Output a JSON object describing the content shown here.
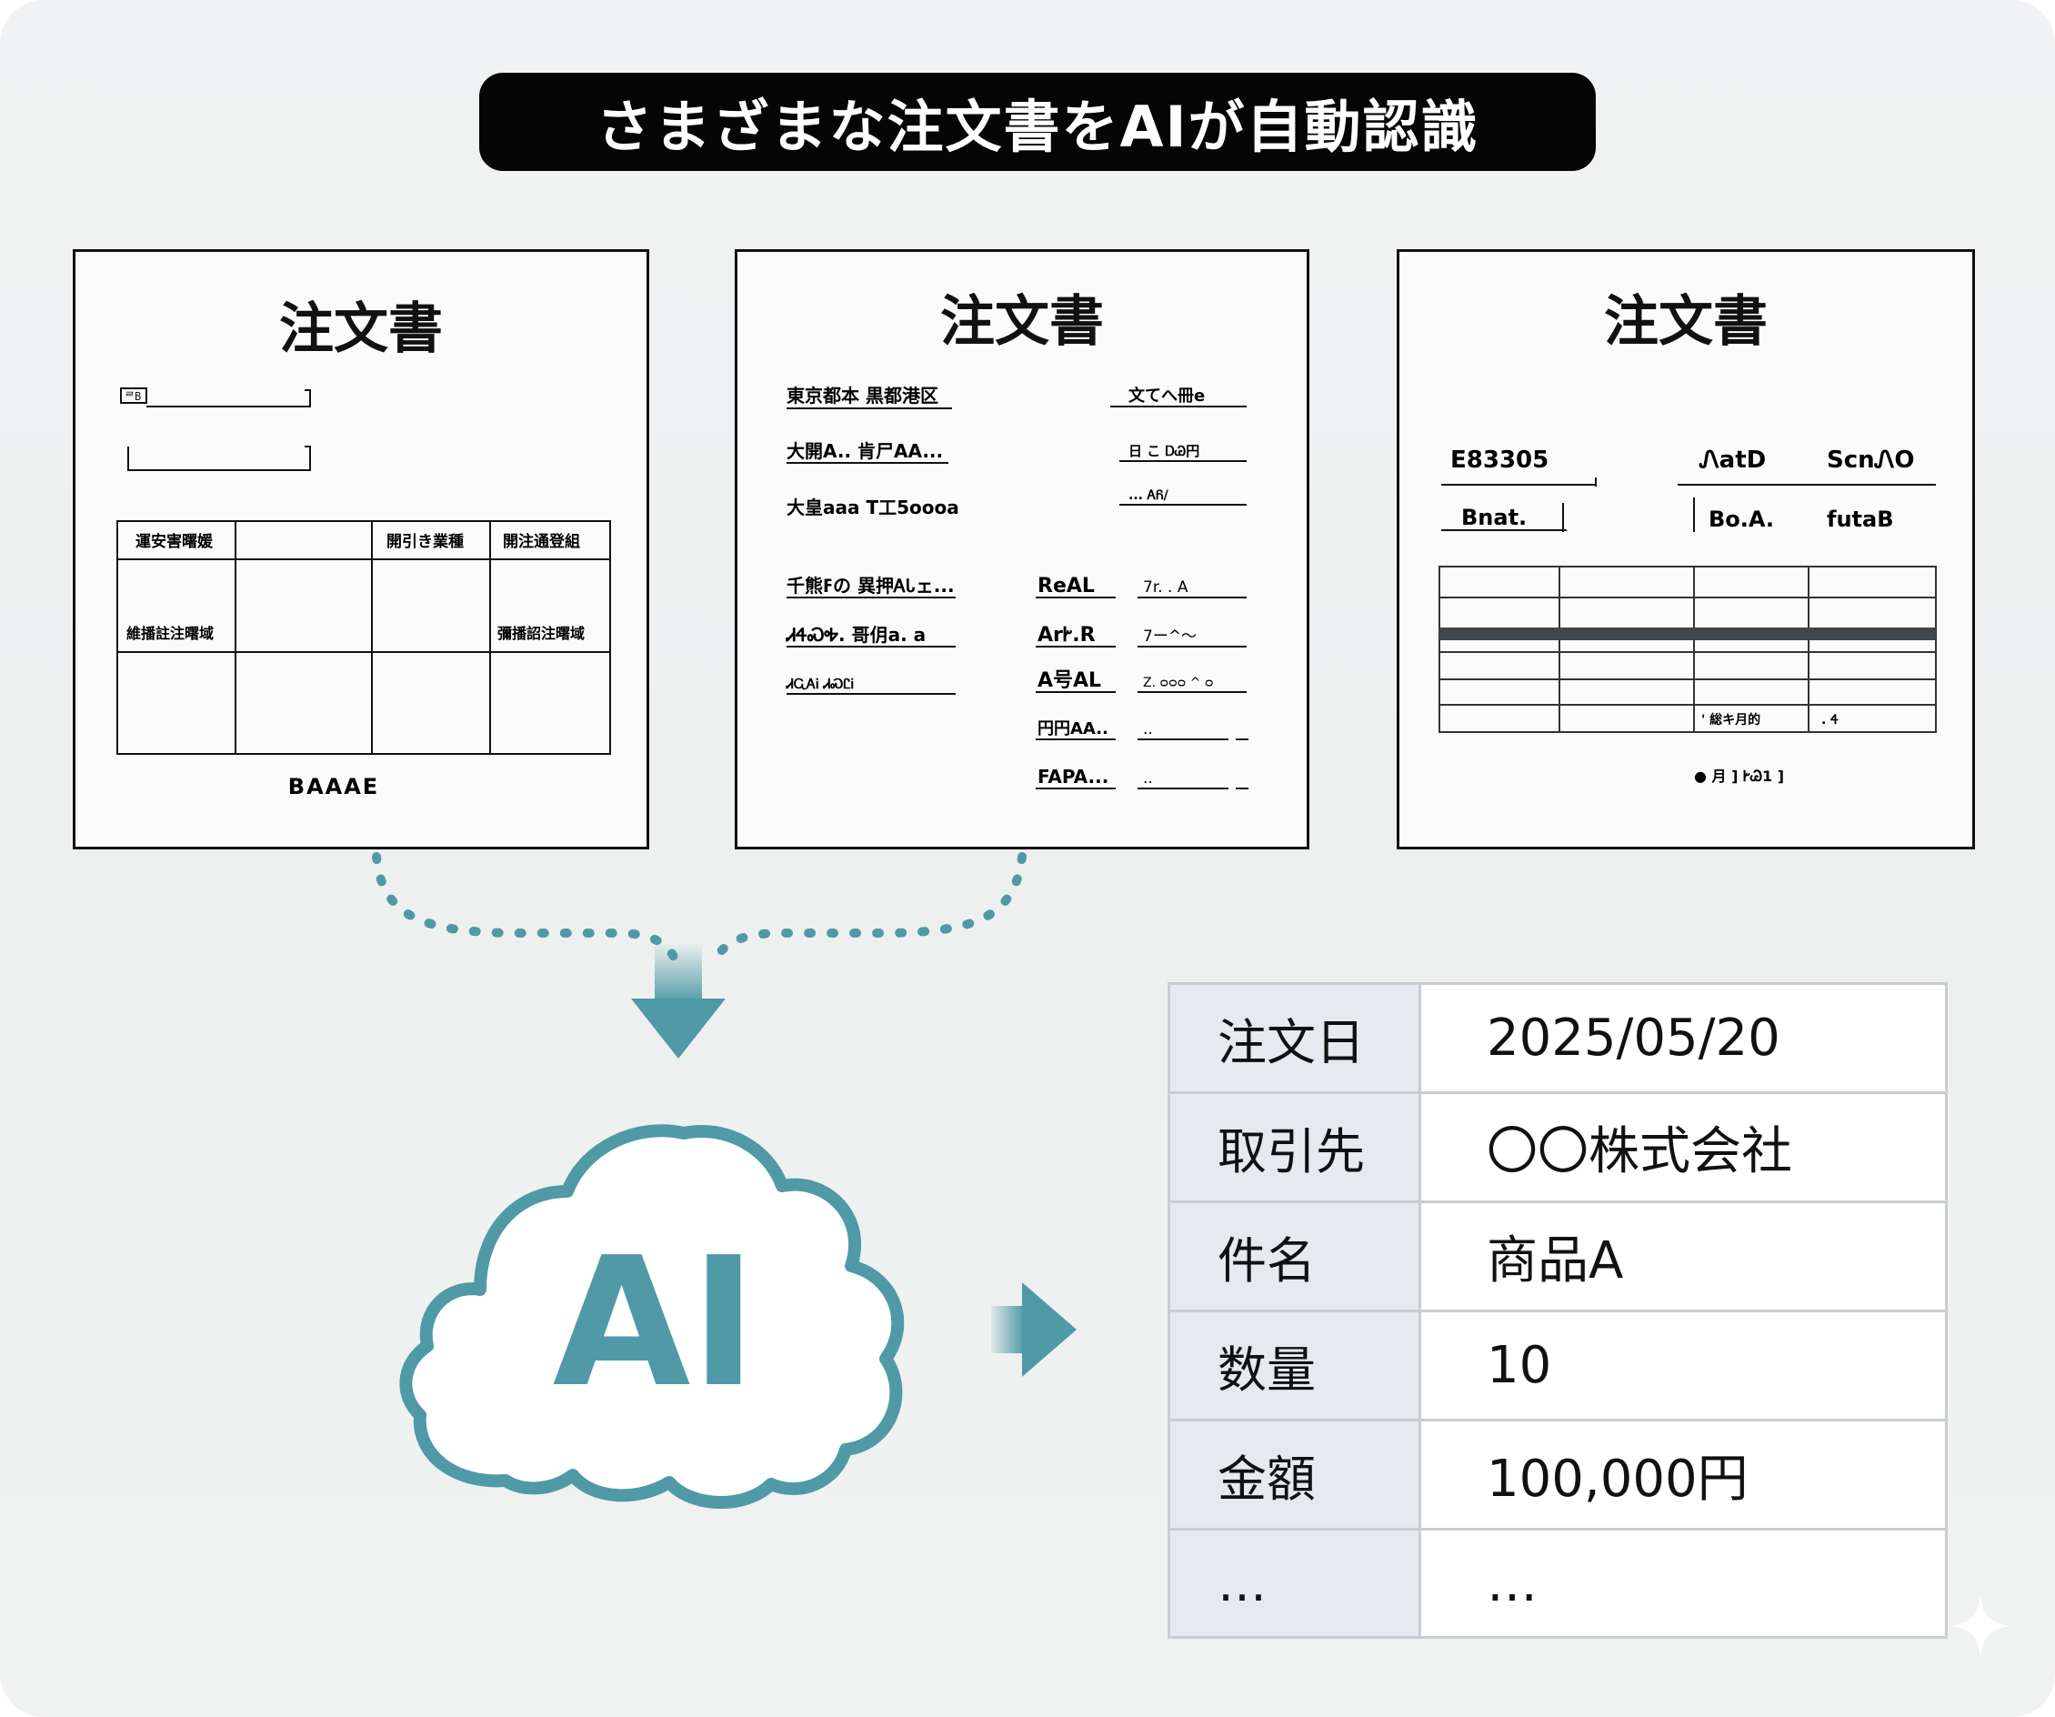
{
  "title": "さまざまな注文書をAIが自動認識",
  "documents": [
    {
      "heading": "注文書",
      "header_box_label": "ᄅB",
      "table_headers": [
        "運安害曙媛",
        "",
        "開引き業種",
        "開注通登組"
      ],
      "table_row_labels": [
        "維播註注曙域",
        "",
        "",
        "彌播詔注曙域"
      ],
      "footer": "BAAAE"
    },
    {
      "heading": "注文書",
      "left_lines": [
        "東京都本 黒都港区",
        "大開A.. 肯尸AA...",
        "大皇ааа T工5оооа",
        "千熊ߓの 異押ᎪᏓェ...",
        "ᏗᏎᏍᎭ. 哥仴a. a",
        "ᏗᏩᎪᎥ ᏗᏍᏝᎥ"
      ],
      "right_top_lines": [
        "文てへ冊e",
        "日 こ ᎠᏊ円",
        "... ᎪᏲ/"
      ],
      "right_col_a": [
        "ReAL",
        "ArᎨ.R",
        "A号AL",
        "円円AA..",
        "FAPA..."
      ],
      "right_col_b": [
        "7r. . A",
        "7ー^〜",
        "Z. ᴑᴑᴑ ^ ᴑ",
        "..",
        ".."
      ]
    },
    {
      "heading": "注文書",
      "code": "E83305",
      "h2": "ᏁatD",
      "h3": "ScnᏁO",
      "l1": "Bnat.",
      "l2": "Bo.A.",
      "l3": "futaB",
      "note1": "' 総キ月的",
      "note2": ". Ꮞ",
      "footer": "● 月 ] ᎨᏊ1   ]"
    }
  ],
  "cloud_label": "AI",
  "result_rows": [
    {
      "key": "注文日",
      "value": "2025/05/20"
    },
    {
      "key": "取引先",
      "value": "〇〇株式会社"
    },
    {
      "key": "件名",
      "value": "商品A"
    },
    {
      "key": "数量",
      "value": "10"
    },
    {
      "key": "金額",
      "value": "100,000円"
    },
    {
      "key": "…",
      "value": "…"
    }
  ],
  "colors": {
    "accent": "#4f9aa6",
    "title_bg": "#050505",
    "key_bg": "#e4eaee"
  }
}
